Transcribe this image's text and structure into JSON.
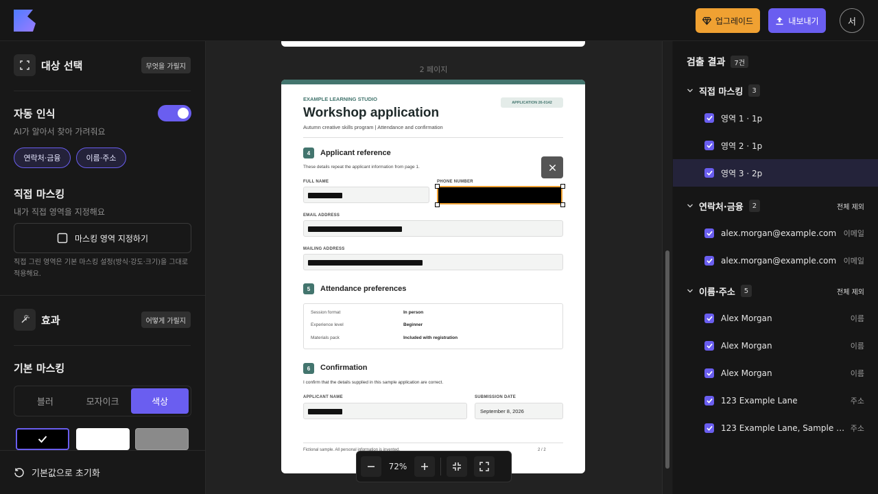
{
  "header": {
    "upgrade_label": "업그레이드",
    "export_label": "내보내기",
    "avatar_initial": "서"
  },
  "left": {
    "target": {
      "title": "대상 선택",
      "hint_button": "무엇을 가릴지"
    },
    "auto": {
      "title": "자동 인식",
      "subtitle": "AI가 알아서 찾아 가려줘요",
      "enabled": true,
      "chips": [
        "연락처·금융",
        "이름·주소"
      ]
    },
    "manual": {
      "title": "직접 마스킹",
      "subtitle": "내가 직접 영역을 지정해요",
      "button": "마스킹 영역 지정하기",
      "note": "직접 그린 영역은 기본 마스킹 설정(방식·강도·크기)을 그대로 적용해요."
    },
    "effects": {
      "title": "효과",
      "hint_button": "어떻게 가릴지"
    },
    "basic": {
      "title": "기본 마스킹",
      "modes": [
        "블러",
        "모자이크",
        "색상"
      ],
      "selected_mode": "색상",
      "swatches": [
        "#000000",
        "#ffffff",
        "#8a8a8a"
      ],
      "selected_swatch": "#000000"
    },
    "reset_label": "기본값으로 초기화"
  },
  "viewer": {
    "page_label": "2 페이지",
    "zoom": "72%",
    "document": {
      "org": "EXAMPLE LEARNING STUDIO",
      "title": "Workshop application",
      "subtitle": "Autumn creative skills program | Attendance and confirmation",
      "app_id": "APPLICATION 26-0142",
      "sec4_num": "4",
      "sec4_title": "Applicant reference",
      "sec4_desc": "These details repeat the applicant information from page 1.",
      "full_name_label": "FULL NAME",
      "phone_label": "PHONE NUMBER",
      "email_label": "EMAIL ADDRESS",
      "mailing_label": "MAILING ADDRESS",
      "sec5_num": "5",
      "sec5_title": "Attendance preferences",
      "prefs": [
        {
          "k": "Session format",
          "v": "In person"
        },
        {
          "k": "Experience level",
          "v": "Beginner"
        },
        {
          "k": "Materials pack",
          "v": "Included with registration"
        }
      ],
      "sec6_num": "6",
      "sec6_title": "Confirmation",
      "sec6_desc": "I confirm that the details supplied in this sample application are correct.",
      "applicant_label": "APPLICANT NAME",
      "date_label": "SUBMISSION DATE",
      "date_value": "September 8, 2026",
      "footer_left": "Fictional sample. All personal information is invented.",
      "footer_right": "2 / 2"
    }
  },
  "results": {
    "title": "검출 결과",
    "count": "7건",
    "groups": [
      {
        "name": "직접 마스킹",
        "count": "3",
        "action": "",
        "items": [
          {
            "label": "영역 1 · 1p",
            "tag": ""
          },
          {
            "label": "영역 2 · 1p",
            "tag": ""
          },
          {
            "label": "영역 3 · 2p",
            "tag": ""
          }
        ]
      },
      {
        "name": "연락처·금융",
        "count": "2",
        "action": "전체 제외",
        "items": [
          {
            "label": "alex.morgan@example.com",
            "tag": "이메일"
          },
          {
            "label": "alex.morgan@example.com",
            "tag": "이메일"
          }
        ]
      },
      {
        "name": "이름·주소",
        "count": "5",
        "action": "전체 제외",
        "items": [
          {
            "label": "Alex Morgan",
            "tag": "이름"
          },
          {
            "label": "Alex Morgan",
            "tag": "이름"
          },
          {
            "label": "Alex Morgan",
            "tag": "이름"
          },
          {
            "label": "123 Example Lane",
            "tag": "주소"
          },
          {
            "label": "123 Example Lane, Sample City, E...",
            "tag": "주소"
          }
        ]
      }
    ]
  },
  "colors": {
    "accent": "#6a5ef0",
    "upgrade": "#f0a132",
    "doc_teal": "#43756e"
  }
}
